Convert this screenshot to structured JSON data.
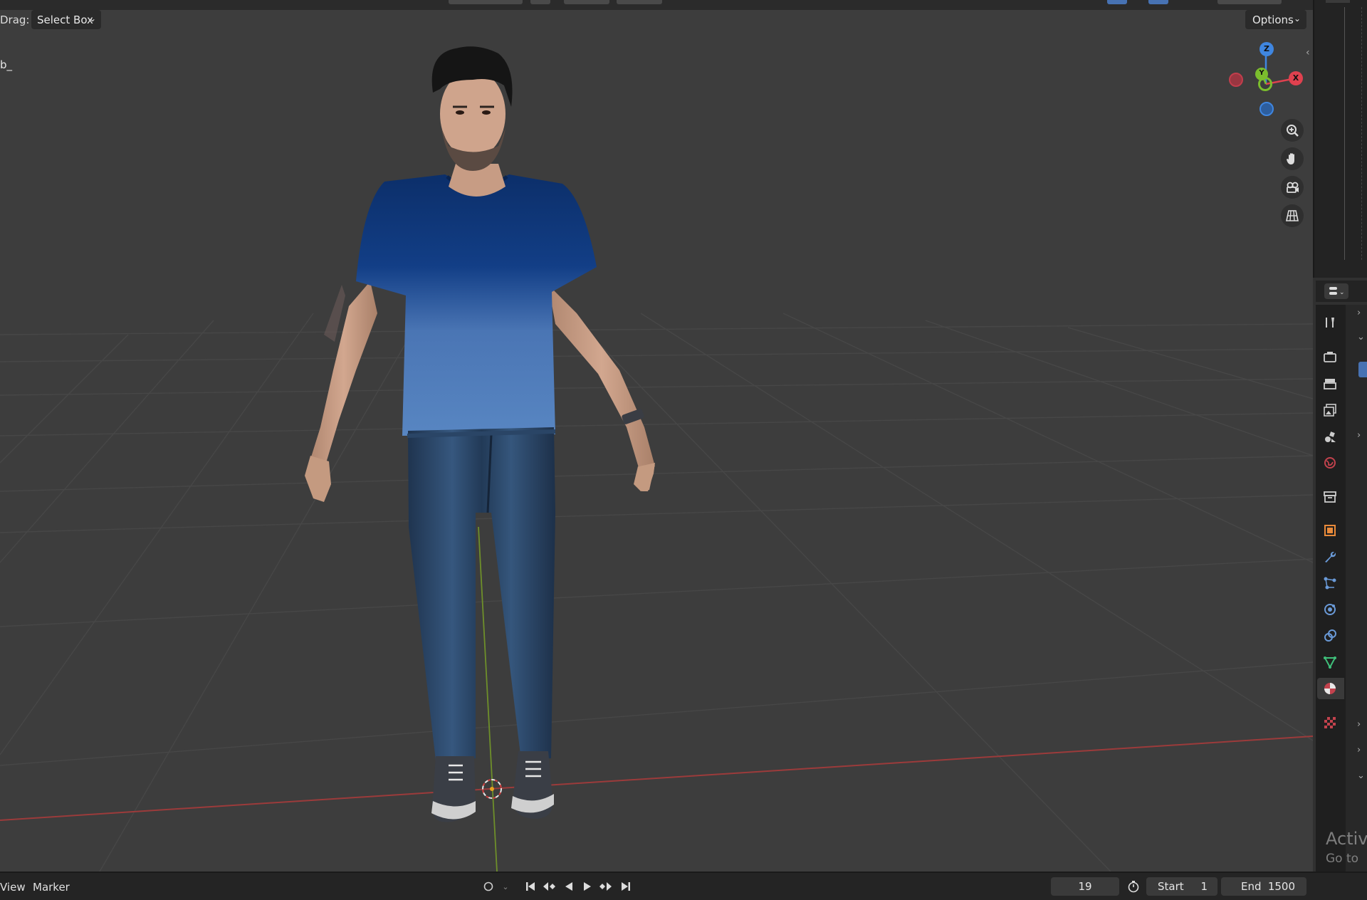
{
  "viewport": {
    "drag_label": "Drag:",
    "select_mode": "Select Box",
    "object_name": "b_",
    "options_label": "Options",
    "gizmo": {
      "z_label": "Z",
      "x_label": "X",
      "y_label": "Y"
    }
  },
  "properties": {
    "tabs": [
      "tool",
      "render",
      "output",
      "view-layer",
      "scene",
      "world",
      "collection",
      "object",
      "modifiers",
      "particles",
      "physics",
      "constraints",
      "data",
      "material",
      "texture"
    ],
    "active_tab": "material"
  },
  "timeline": {
    "view_label": "View",
    "marker_label": "Marker",
    "current_frame": "19",
    "start_label": "Start",
    "start_value": "1",
    "end_label": "End",
    "end_value": "1500"
  },
  "watermark": {
    "line1": "Activ",
    "line2": "Go to"
  },
  "colors": {
    "accent_blue": "#4772b3",
    "axis_x": "#e0414f",
    "axis_y": "#7bbd2d",
    "axis_z": "#3f86e0"
  }
}
